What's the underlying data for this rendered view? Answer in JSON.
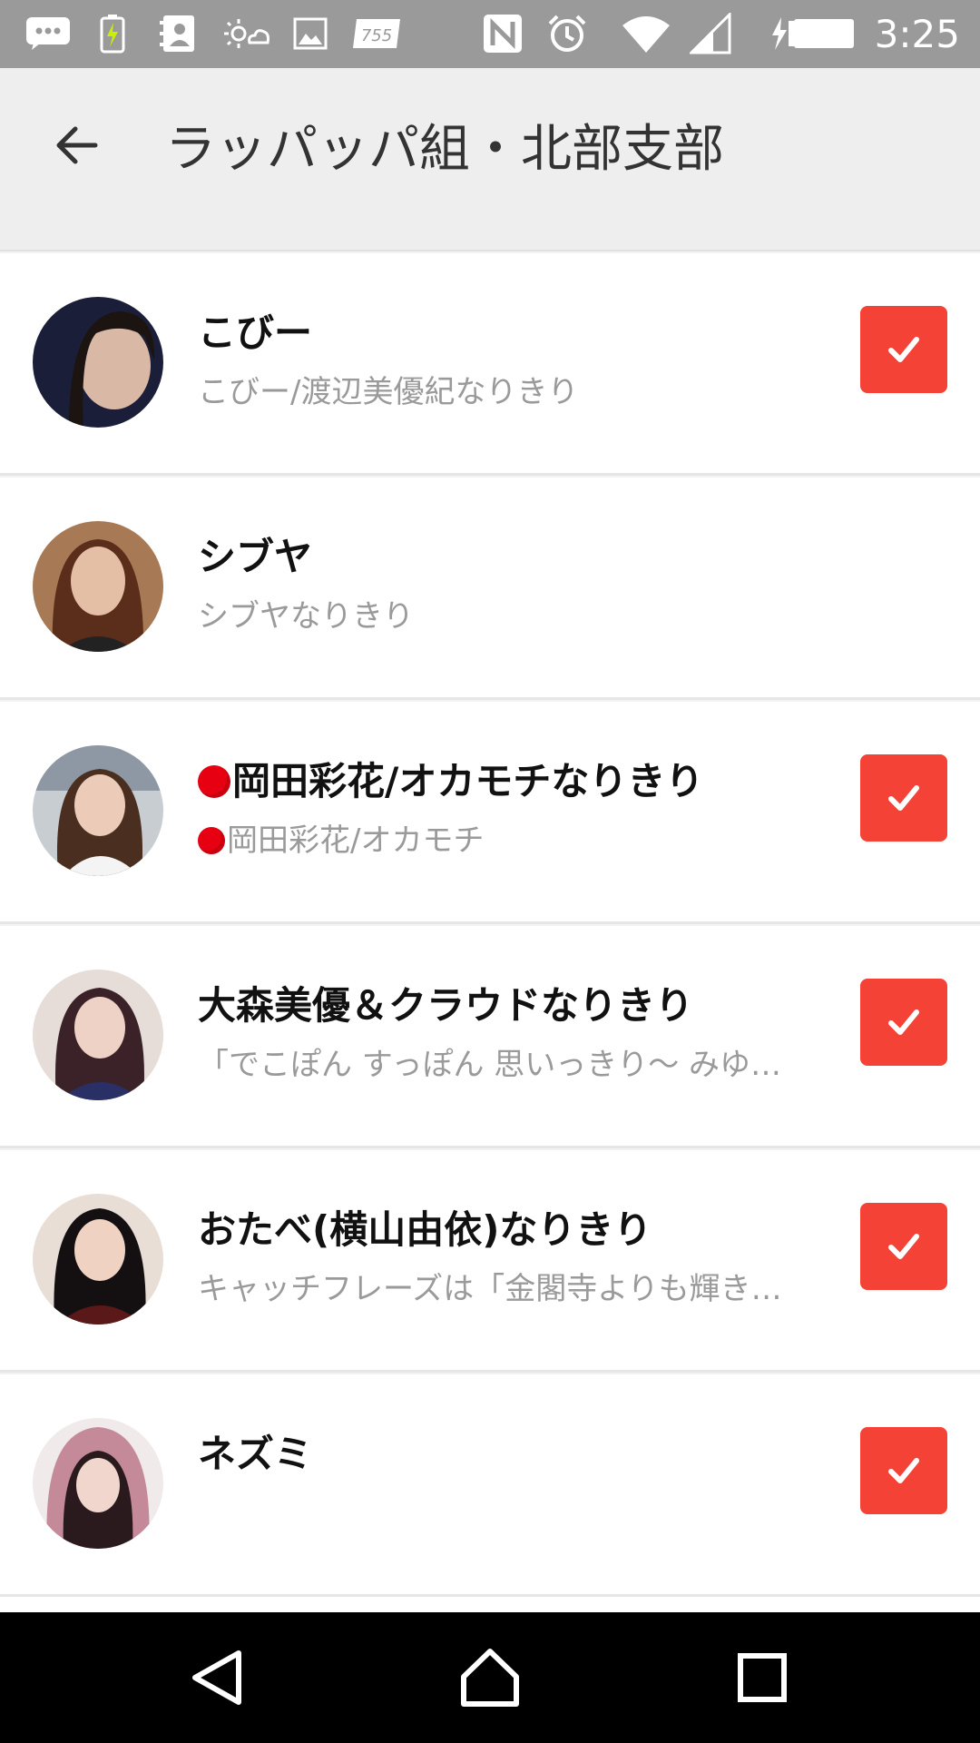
{
  "status_bar": {
    "time": "3:25",
    "icons": [
      "message-icon",
      "battery-charging-icon",
      "contacts-icon",
      "weather-icon",
      "image-icon",
      "tss-icon",
      "nfc-icon",
      "alarm-icon",
      "wifi-icon",
      "signal-icon",
      "battery-icon"
    ],
    "tss_label": "755"
  },
  "header": {
    "title": "ラッパッパ組・北部支部",
    "back_icon": "arrow-left-icon"
  },
  "members": [
    {
      "name": "こびー",
      "subtitle": "こびー/渡辺美優紀なりきり",
      "name_dot": false,
      "sub_dot": false,
      "checked": true,
      "avatar_color": "#2a2f4a"
    },
    {
      "name": "シブヤ",
      "subtitle": "シブヤなりきり",
      "name_dot": false,
      "sub_dot": false,
      "checked": false,
      "avatar_color": "#8a5a3c"
    },
    {
      "name": "岡田彩花/オカモチなりきり",
      "subtitle": "岡田彩花/オカモチ",
      "name_dot": true,
      "sub_dot": true,
      "checked": true,
      "avatar_color": "#a9b0b8"
    },
    {
      "name": "大森美優＆クラウドなりきり",
      "subtitle": "「でこぽん すっぽん 思いっきり〜 みゆ…",
      "name_dot": false,
      "sub_dot": false,
      "checked": true,
      "avatar_color": "#3b3a5e"
    },
    {
      "name": "おたべ(横山由依)なりきり",
      "subtitle": "キャッチフレーズは「金閣寺よりも輝き…",
      "name_dot": false,
      "sub_dot": false,
      "checked": true,
      "avatar_color": "#5a2424"
    },
    {
      "name": "ネズミ",
      "subtitle": "",
      "name_dot": false,
      "sub_dot": false,
      "checked": true,
      "avatar_color": "#b48a95"
    }
  ],
  "colors": {
    "accent": "#f44336",
    "status_bar": "#9a9a9a",
    "app_bar": "#eeeeee",
    "nav_bar": "#000000"
  },
  "nav_bar": {
    "icons": [
      "back-triangle-icon",
      "home-icon",
      "recents-icon"
    ]
  }
}
